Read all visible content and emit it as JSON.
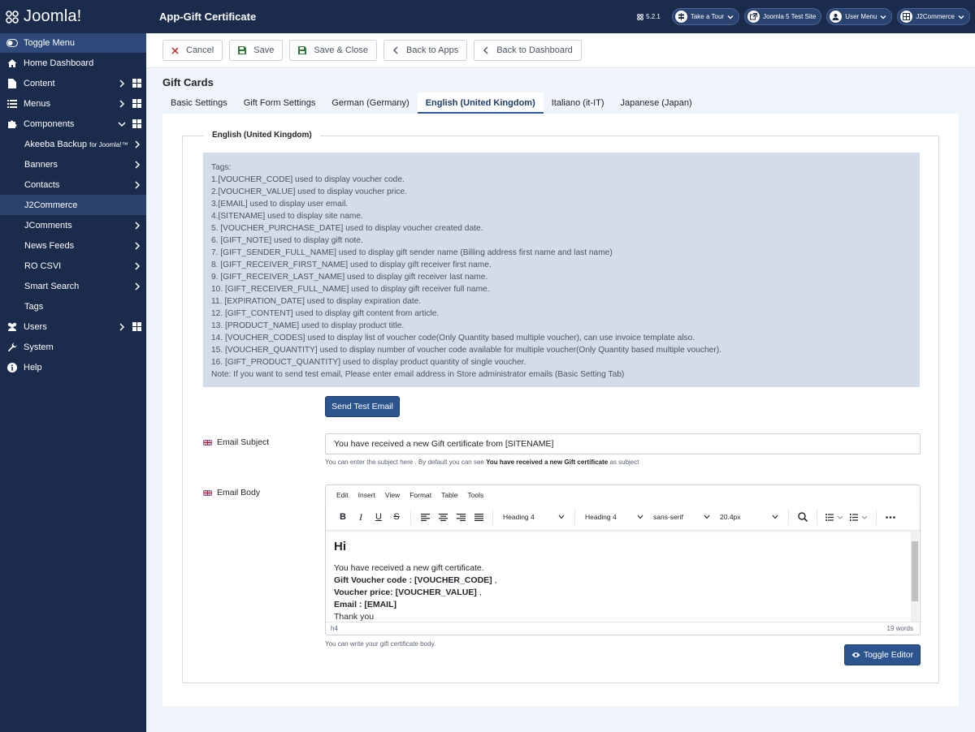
{
  "brand": {
    "name": "Joomla!"
  },
  "sidebar": {
    "toggle_label": "Toggle Menu",
    "items": [
      {
        "label": "Home Dashboard"
      },
      {
        "label": "Content"
      },
      {
        "label": "Menus"
      },
      {
        "label": "Components"
      },
      {
        "label": "Akeeba Backup",
        "suffix": "for Joomla!™"
      },
      {
        "label": "Banners"
      },
      {
        "label": "Contacts"
      },
      {
        "label": "J2Commerce"
      },
      {
        "label": "JComments"
      },
      {
        "label": "News Feeds"
      },
      {
        "label": "RO CSVI"
      },
      {
        "label": "Smart Search"
      },
      {
        "label": "Tags"
      },
      {
        "label": "Users"
      },
      {
        "label": "System"
      },
      {
        "label": "Help"
      }
    ]
  },
  "header": {
    "title": "App-Gift Certificate",
    "version": "5.2.1",
    "take_tour": "Take a Tour",
    "site": "Joomla 5 Test Site",
    "user_menu": "User Menu",
    "j2commerce": "J2Commerce"
  },
  "toolbar": {
    "cancel": "Cancel",
    "save": "Save",
    "save_close": "Save & Close",
    "back_apps": "Back to Apps",
    "back_dashboard": "Back to Dashboard"
  },
  "page": {
    "section_title": "Gift Cards",
    "tabs": [
      {
        "label": "Basic Settings"
      },
      {
        "label": "Gift Form Settings"
      },
      {
        "label": "German (Germany)"
      },
      {
        "label": "English (United Kingdom)"
      },
      {
        "label": "Italiano (it-IT)"
      },
      {
        "label": "Japanese (Japan)"
      }
    ],
    "legend": "English (United Kingdom)",
    "tags": [
      "Tags:",
      "1.[VOUCHER_CODE] used to display voucher code.",
      "2.[VOUCHER_VALUE] used to display voucher price.",
      "3.[EMAIL] used to display user email.",
      "4.[SITENAME] used to display site name.",
      "5. [VOUCHER_PURCHASE_DATE] used to display voucher created date.",
      "6. [GIFT_NOTE] used to display gift note.",
      "7. [GIFT_SENDER_FULL_NAME] used to display gift sender name (Billing address first name and last name)",
      "8. [GIFT_RECEIVER_FIRST_NAME] used to display gift receiver first name.",
      "9. [GIFT_RECEIVER_LAST_NAME] used to display gift receiver last name.",
      "10. [GIFT_RECEIVER_FULL_NAME] used to display gift receiver full name.",
      "11. [EXPIRATION_DATE] used to display expiration date.",
      "12. [GIFT_CONTENT] used to display gift content from article.",
      "13. [PRODUCT_NAME] used to display product title.",
      "14. [VOUCHER_CODES] used to display list of voucher code(Only Quantity based multiple voucher), can use invoice template also.",
      "15. [VOUCHER_QUANTITY] used to display number of voucher code available for multiple voucher(Only Quantity based multiple voucher).",
      "16. [GIFT_PRODUCT_QUANTITY] used to display product quantity of single voucher.",
      "Note: If you want to send test email, Please enter email address in Store administrator emails (Basic Setting Tab)"
    ],
    "send_test_email": "Send Test Email",
    "subject_label": "Email Subject",
    "subject_value": "You have received a new Gift certificate from [SITENAME]",
    "subject_help_pre": "You can enter the subject here . By default you can see",
    "subject_help_bold": "You have received a new Gift certificate",
    "subject_help_post": "as subject",
    "body_label": "Email Body",
    "body_help": "You can write your gift certificate body.",
    "toggle_editor": "Toggle Editor"
  },
  "editor": {
    "menus": [
      "Edit",
      "Insert",
      "View",
      "Format",
      "Table",
      "Tools"
    ],
    "block_format_1": "Heading 4",
    "block_format_2": "Heading 4",
    "font_family": "sans-serif",
    "font_size": "20.4px",
    "content": {
      "heading": "Hi",
      "line1": "You have received a new gift certificate.",
      "code_label": "Gift Voucher code : [VOUCHER_CODE]",
      "code_suffix": " ,",
      "price_label": "Voucher price: [VOUCHER_VALUE]",
      "price_suffix": " ,",
      "email_label": "Email : [EMAIL]",
      "thanks": "Thank you"
    },
    "status_path": "h4",
    "word_count": "19 words"
  }
}
